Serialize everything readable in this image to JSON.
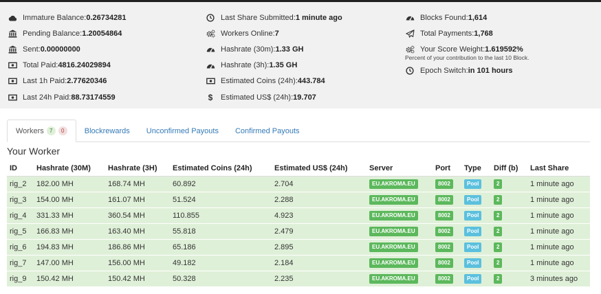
{
  "stats": {
    "col1": [
      {
        "icon": "cloud-icon",
        "label": "Immature Balance: ",
        "value": "0.26734281"
      },
      {
        "icon": "bank-icon",
        "label": "Pending Balance: ",
        "value": "1.20054864"
      },
      {
        "icon": "bank-icon",
        "label": "Sent: ",
        "value": "0.00000000"
      },
      {
        "icon": "money-icon",
        "label": "Total Paid: ",
        "value": "4816.24029894"
      },
      {
        "icon": "money-icon",
        "label": "Last 1h Paid: ",
        "value": "2.77620346"
      },
      {
        "icon": "money-icon",
        "label": "Last 24h Paid: ",
        "value": "88.73174559"
      }
    ],
    "col2": [
      {
        "icon": "clock-icon",
        "label": "Last Share Submitted: ",
        "value": "1 minute ago"
      },
      {
        "icon": "cogs-icon",
        "label": "Workers Online: ",
        "value": "7"
      },
      {
        "icon": "tachometer-icon",
        "label": "Hashrate (30m): ",
        "value": "1.33 GH"
      },
      {
        "icon": "tachometer-icon",
        "label": "Hashrate (3h): ",
        "value": "1.35 GH"
      },
      {
        "icon": "money-icon",
        "label": "Estimated Coins (24h): ",
        "value": "443.784"
      },
      {
        "icon": "dollar-icon",
        "label": "Estimated US$ (24h): ",
        "value": "19.707"
      }
    ],
    "col3": [
      {
        "icon": "tachometer-icon",
        "label": "Blocks Found: ",
        "value": "1,614"
      },
      {
        "icon": "paper-plane-icon",
        "label": "Total Payments: ",
        "value": "1,768"
      },
      {
        "icon": "cogs-icon",
        "label": "Your Score Weight: ",
        "value": "1.619592%"
      }
    ],
    "score_note": "Percent of your contribution to the last 10 Block.",
    "epoch": {
      "icon": "clock-icon",
      "label": "Epoch Switch: ",
      "value": "in 101 hours"
    }
  },
  "tabs": {
    "workers": "Workers",
    "workers_online": "7",
    "workers_offline": "0",
    "blockrewards": "Blockrewards",
    "unconfirmed": "Unconfirmed Payouts",
    "confirmed": "Confirmed Payouts"
  },
  "section_title": "Your Worker",
  "table": {
    "headers": [
      "ID",
      "Hashrate (30M)",
      "Hashrate (3H)",
      "Estimated Coins (24h)",
      "Estimated US$ (24h)",
      "Server",
      "Port",
      "Type",
      "Diff (b)",
      "Last Share"
    ],
    "rows": [
      [
        "rig_2",
        "182.00 MH",
        "168.74 MH",
        "60.892",
        "2.704",
        "EU.AKROMA.EU",
        "8002",
        "Pool",
        "2",
        "1 minute ago"
      ],
      [
        "rig_3",
        "154.00 MH",
        "161.07 MH",
        "51.524",
        "2.288",
        "EU.AKROMA.EU",
        "8002",
        "Pool",
        "2",
        "1 minute ago"
      ],
      [
        "rig_4",
        "331.33 MH",
        "360.54 MH",
        "110.855",
        "4.923",
        "EU.AKROMA.EU",
        "8002",
        "Pool",
        "2",
        "1 minute ago"
      ],
      [
        "rig_5",
        "166.83 MH",
        "163.40 MH",
        "55.818",
        "2.479",
        "EU.AKROMA.EU",
        "8002",
        "Pool",
        "2",
        "1 minute ago"
      ],
      [
        "rig_6",
        "194.83 MH",
        "186.86 MH",
        "65.186",
        "2.895",
        "EU.AKROMA.EU",
        "8002",
        "Pool",
        "2",
        "1 minute ago"
      ],
      [
        "rig_7",
        "147.00 MH",
        "156.00 MH",
        "49.182",
        "2.184",
        "EU.AKROMA.EU",
        "8002",
        "Pool",
        "2",
        "1 minute ago"
      ],
      [
        "rig_9",
        "150.42 MH",
        "150.42 MH",
        "50.328",
        "2.235",
        "EU.AKROMA.EU",
        "8002",
        "Pool",
        "2",
        "3 minutes ago"
      ]
    ]
  }
}
